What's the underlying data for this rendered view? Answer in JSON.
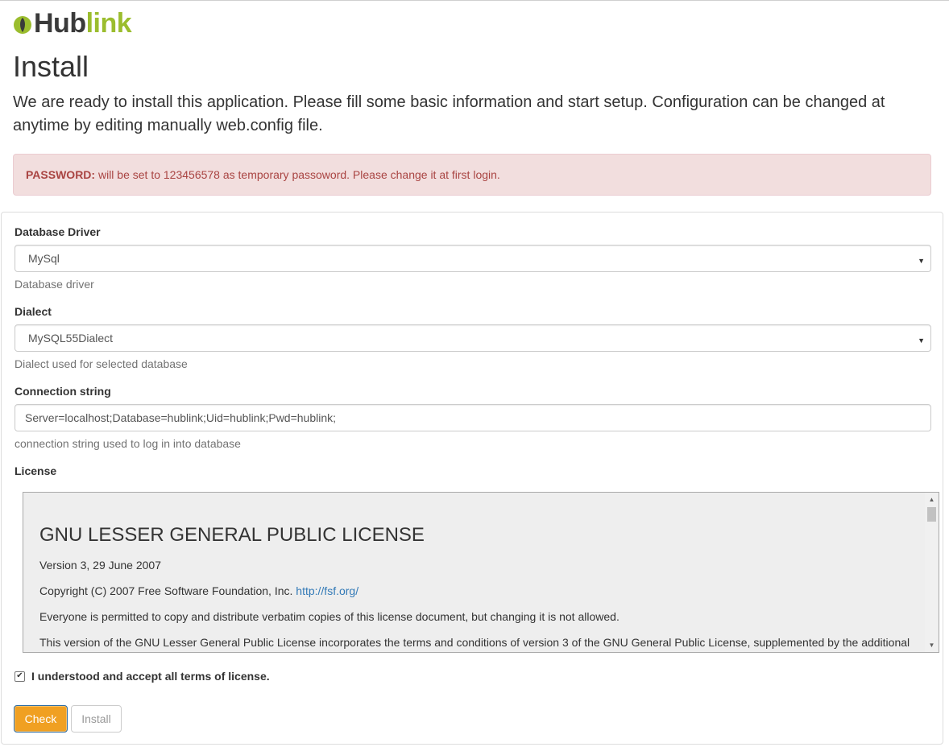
{
  "brand": {
    "hub": "Hub",
    "link": "link",
    "mark_color": "#9bbd2e"
  },
  "page": {
    "title": "Install",
    "lead": "We are ready to install this application. Please fill some basic information and start setup. Configuration can be changed at anytime by editing manually web.config file."
  },
  "alert": {
    "label": "PASSWORD:",
    "text": " will be set to 123456578 as temporary passoword. Please change it at first login."
  },
  "form": {
    "driver": {
      "label": "Database Driver",
      "value": "MySql",
      "help": "Database driver"
    },
    "dialect": {
      "label": "Dialect",
      "value": "MySQL55Dialect",
      "help": "Dialect used for selected database"
    },
    "connection": {
      "label": "Connection string",
      "value": "Server=localhost;Database=hublink;Uid=hublink;Pwd=hublink;",
      "help": "connection string used to log in into database"
    },
    "license": {
      "label": "License",
      "heading": "GNU LESSER GENERAL PUBLIC LICENSE",
      "version": "Version 3, 29 June 2007",
      "copyright": "Copyright (C) 2007 Free Software Foundation, Inc. ",
      "link": "http://fsf.org/",
      "p1": "Everyone is permitted to copy and distribute verbatim copies of this license document, but changing it is not allowed.",
      "p2": "This version of the GNU Lesser General Public License incorporates the terms and conditions of version 3 of the GNU General Public License, supplemented by the additional permissions listed below."
    },
    "accept": {
      "label": "I understood and accept all terms of license.",
      "checked": true
    },
    "buttons": {
      "check": "Check",
      "install": "Install"
    }
  },
  "colors": {
    "accent": "#f0a022",
    "alert_bg": "#f2dede",
    "alert_text": "#a94442",
    "link": "#337ab7"
  }
}
